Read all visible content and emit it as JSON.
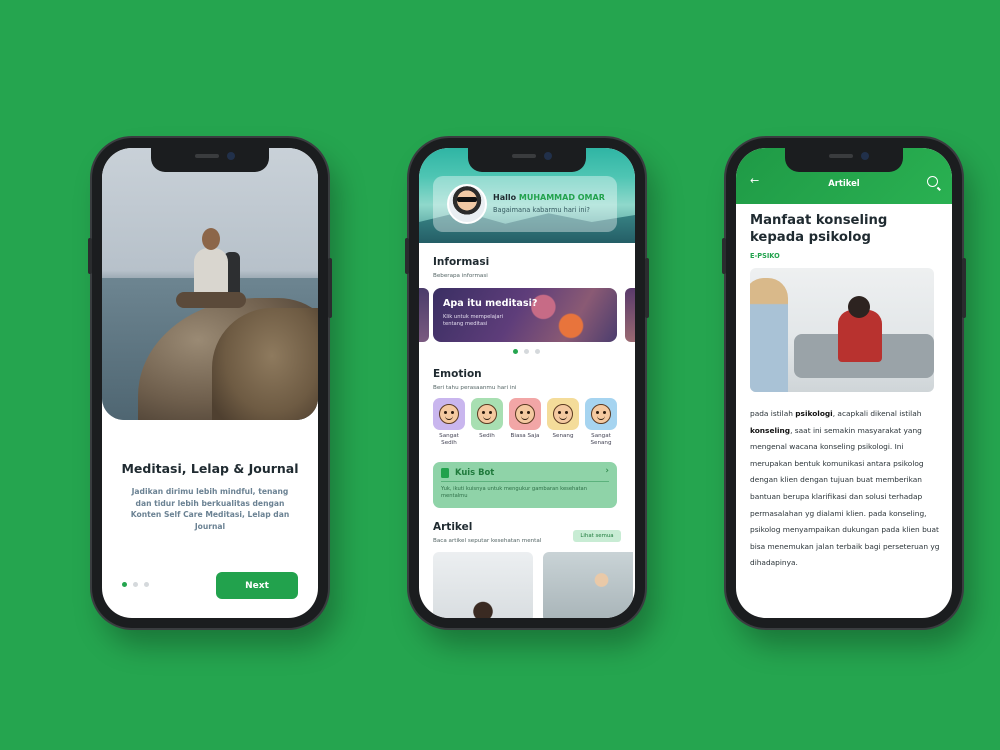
{
  "phone1": {
    "title": "Meditasi, Lelap & Journal",
    "description": "Jadikan dirimu lebih mindful, tenang dan tidur lebih berkualitas dengan Konten Self Care Meditasi, Lelap dan Journal",
    "next_label": "Next",
    "pager_active": 0
  },
  "phone2": {
    "greeting_prefix": "Hallo",
    "user_name": "MUHAMMAD OMAR",
    "greeting_sub": "Bagaimana kabarmu hari ini?",
    "info_title": "Informasi",
    "info_sub": "Beberapa informasi",
    "info_card_title": "Apa itu meditasi?",
    "info_card_sub": "Klik untuk mempelajari tentang meditasi",
    "emotion_title": "Emotion",
    "emotion_sub": "Beri tahu perasaanmu hari ini",
    "emotions": [
      {
        "label": "Sangat Sedih",
        "color": "#c9b6ee"
      },
      {
        "label": "Sedih",
        "color": "#a8dfb2"
      },
      {
        "label": "Biasa Saja",
        "color": "#f2a6a6"
      },
      {
        "label": "Senang",
        "color": "#f4dc9a"
      },
      {
        "label": "Sangat Senang",
        "color": "#a6d4f0"
      }
    ],
    "kuis_title": "Kuis Bot",
    "kuis_sub": "Yuk, ikuti kuisnya untuk mengukur gambaran kesehatan mentalmu",
    "artikel_title": "Artikel",
    "artikel_sub": "Baca artikel seputar kesehatan mental",
    "lihat_label": "Lihat semua"
  },
  "phone3": {
    "bar_title": "Artikel",
    "article_title": "Manfaat konseling kepada psikolog",
    "source": "E-PSIKO",
    "body": {
      "p1": "pada istilah ",
      "b1": "psikologi",
      "p2": ", acapkali dikenal istilah ",
      "b2": "konseling",
      "p3": ", saat ini semakin masyarakat yang mengenal wacana konseling psikologi. Ini merupakan bentuk komunikasi antara psikolog dengan klien dengan tujuan buat memberikan bantuan berupa klarifikasi dan solusi terhadap permasalahan yg dialami klien. pada konseling, psikolog menyampaikan dukungan pada klien buat bisa menemukan jalan terbaik bagi perseteruan yg dihadapinya."
    }
  }
}
